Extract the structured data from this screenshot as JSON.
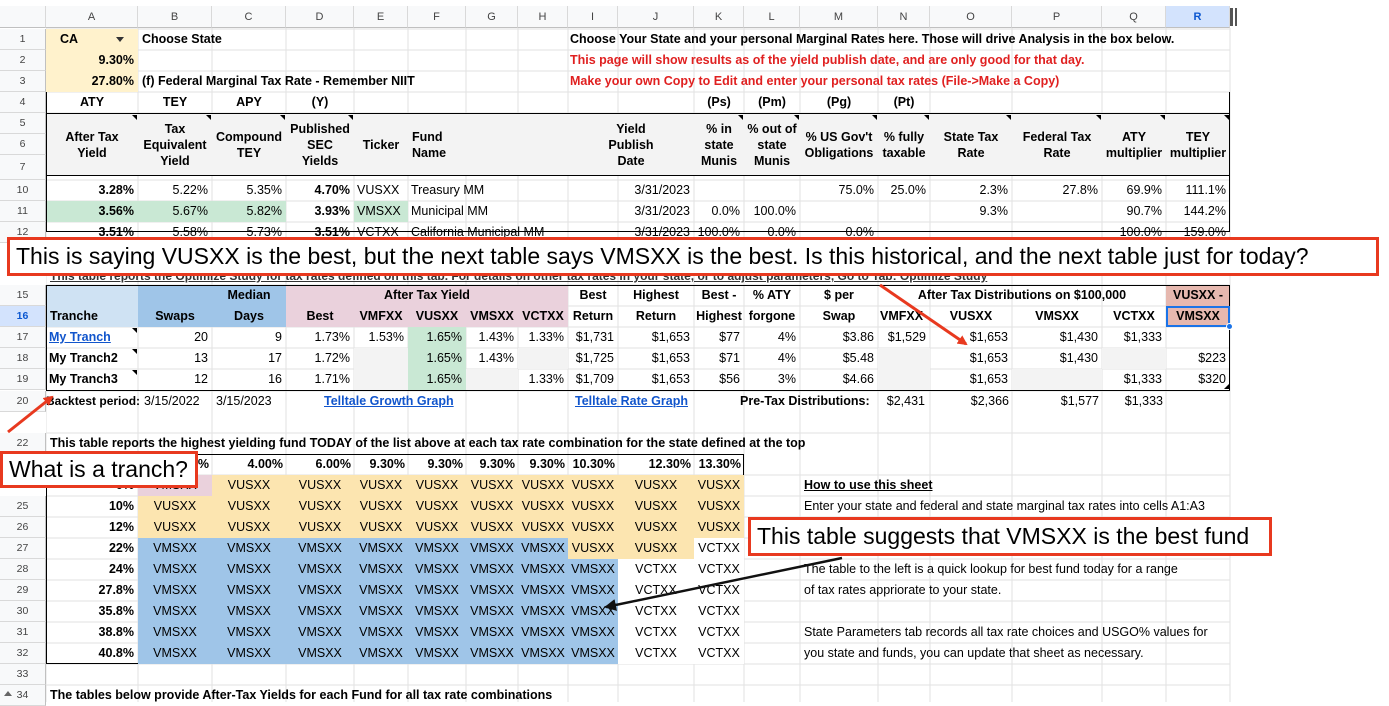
{
  "columns": [
    "A",
    "B",
    "C",
    "D",
    "E",
    "F",
    "G",
    "H",
    "I",
    "J",
    "K",
    "L",
    "M",
    "N",
    "O",
    "P",
    "Q",
    "R"
  ],
  "selected_column": "R",
  "row_numbers": [
    "1",
    "2",
    "3",
    "4",
    "5",
    "6",
    "7",
    "10",
    "11",
    "12",
    "15",
    "16",
    "17",
    "18",
    "19",
    "20",
    "22",
    "25",
    "26",
    "27",
    "28",
    "29",
    "30",
    "31",
    "32",
    "33",
    "34"
  ],
  "selected_row": "16",
  "state_select": {
    "value": "CA"
  },
  "top": {
    "choose_state": "Choose State",
    "state_rate": "9.30%",
    "fed_rate": "27.80%",
    "fed_label": "(f) Federal Marginal Tax Rate - Remember NIIT",
    "instr1": "Choose Your State and your personal Marginal Rates here. Those will drive Analysis in the box below.",
    "instr2": "This page will show results as of the yield publish date, and are only good for that day.",
    "instr3": "Make your own Copy to Edit and enter your personal tax rates (File->Make a Copy)"
  },
  "hdr_row4": {
    "a": "ATY",
    "b": "TEY",
    "c": "APY",
    "d": "(Y)",
    "k": "(Ps)",
    "l": "(Pm)",
    "m": "(Pg)",
    "n": "(Pt)"
  },
  "headers": {
    "a": "After Tax\nYield",
    "b": "Tax\nEquivalent\nYield",
    "c": "Compound\nTEY",
    "d": "Published\nSEC\nYields",
    "e": "Ticker",
    "f": "Fund\nName",
    "j": "Yield\nPublish\nDate",
    "k": "% in\nstate\nMunis",
    "l": "% out of\nstate\nMunis",
    "m": "% US Gov't\nObligations",
    "n": "% fully\ntaxable",
    "o": "State Tax\nRate",
    "p": "Federal Tax\nRate",
    "q": "ATY\nmultiplier",
    "r": "TEY\nmultiplier"
  },
  "fund_rows": [
    {
      "rn": "10",
      "a": "3.28%",
      "b": "5.22%",
      "c": "5.35%",
      "d": "4.70%",
      "e": "VUSXX",
      "f": "Treasury MM",
      "j": "3/31/2023",
      "k": "",
      "l": "",
      "m": "75.0%",
      "n": "25.0%",
      "o": "2.3%",
      "p": "27.8%",
      "q": "69.9%",
      "r": "111.1%"
    },
    {
      "rn": "11",
      "a": "3.56%",
      "b": "5.67%",
      "c": "5.82%",
      "d": "3.93%",
      "e": "VMSXX",
      "f": "Municipal MM",
      "j": "3/31/2023",
      "k": "0.0%",
      "l": "100.0%",
      "m": "",
      "n": "",
      "o": "9.3%",
      "p": "",
      "q": "90.7%",
      "r": "144.2%"
    },
    {
      "rn": "12",
      "a": "3.51%",
      "b": "5.58%",
      "c": "5.73%",
      "d": "3.51%",
      "e": "VCTXX",
      "f": "California Municipal MM",
      "j": "3/31/2023",
      "k": "100.0%",
      "l": "0.0%",
      "m": "0.0%",
      "n": "",
      "o": "",
      "p": "",
      "q": "100.0%",
      "r": "159.0%"
    }
  ],
  "partial_row14": "This table reports the Optimize Study for tax rates defined on this tab. For details on other tax rates in your state, or to adjust parameters, Go to Tab: Optimize Study",
  "opt": {
    "median": "Median",
    "aty": "After Tax Yield",
    "best": "Best",
    "highest": "Highest",
    "best_minus": "Best -",
    "pct_aty": "% ATY",
    "per": "$ per",
    "dist": "After Tax Distributions on $100,000",
    "vusxx_minus": "VUSXX -",
    "tranche": "Tranche",
    "swaps": "Swaps",
    "days": "Days",
    "best2": "Best",
    "vmfxx": "VMFXX",
    "vusxx": "VUSXX",
    "vmsxx": "VMSXX",
    "vctxx": "VCTXX",
    "ret": "Return",
    "ret2": "Return",
    "highest2": "Highest",
    "forgone": "forgone",
    "swap": "Swap",
    "d_vmfxx": "VMFXX",
    "d_vusxx": "VUSXX",
    "d_vmsxx": "VMSXX",
    "d_vctxx": "VCTXX",
    "r_vmsxx": "VMSXX"
  },
  "tranches": [
    {
      "name": "My Tranch",
      "swaps": "20",
      "days": "9",
      "best": "1.73%",
      "vmfxx": "1.53%",
      "vusxx": "1.65%",
      "vmsxx": "1.43%",
      "vctxx": "1.33%",
      "bret": "$1,731",
      "hret": "$1,653",
      "bmh": "$77",
      "pct": "4%",
      "per": "$3.86",
      "d1": "$1,529",
      "d2": "$1,653",
      "d3": "$1,430",
      "d4": "$1,333",
      "r": ""
    },
    {
      "name": "My Tranch2",
      "swaps": "13",
      "days": "17",
      "best": "1.72%",
      "vmfxx": "",
      "vusxx": "1.65%",
      "vmsxx": "1.43%",
      "vctxx": "",
      "bret": "$1,725",
      "hret": "$1,653",
      "bmh": "$71",
      "pct": "4%",
      "per": "$5.48",
      "d1": "",
      "d2": "$1,653",
      "d3": "$1,430",
      "d4": "",
      "r": "$223"
    },
    {
      "name": "My Tranch3",
      "swaps": "12",
      "days": "16",
      "best": "1.71%",
      "vmfxx": "",
      "vusxx": "1.65%",
      "vmsxx": "",
      "vctxx": "1.33%",
      "bret": "$1,709",
      "hret": "$1,653",
      "bmh": "$56",
      "pct": "3%",
      "per": "$4.66",
      "d1": "",
      "d2": "$1,653",
      "d3": "",
      "d4": "$1,333",
      "r": "$320"
    }
  ],
  "row20": {
    "backtest": "Backtest period:",
    "start": "3/15/2022",
    "end": "3/15/2023",
    "growth": "Telltale Growth  Graph",
    "rate": "Telltale Rate Graph",
    "pretax": "Pre-Tax  Distributions:",
    "v1": "$2,431",
    "v2": "$2,366",
    "v3": "$1,577",
    "v4": "$1,333"
  },
  "row22": "This table reports the highest yielding fund TODAY of the list above at each tax rate combination for the state defined at the top",
  "state_rates": [
    "0%",
    "4.00%",
    "6.00%",
    "9.30%",
    "9.30%",
    "9.30%",
    "9.30%",
    "10.30%",
    "12.30%",
    "13.30%"
  ],
  "lookup": [
    {
      "rn": "24",
      "rate": "0%",
      "cells": [
        "VMSXX",
        "VUSXX",
        "VUSXX",
        "VUSXX",
        "VUSXX",
        "VUSXX",
        "VUSXX",
        "VUSXX",
        "VUSXX",
        "VUSXX"
      ]
    },
    {
      "rn": "25",
      "rate": "10%",
      "cells": [
        "VUSXX",
        "VUSXX",
        "VUSXX",
        "VUSXX",
        "VUSXX",
        "VUSXX",
        "VUSXX",
        "VUSXX",
        "VUSXX",
        "VUSXX"
      ]
    },
    {
      "rn": "26",
      "rate": "12%",
      "cells": [
        "VUSXX",
        "VUSXX",
        "VUSXX",
        "VUSXX",
        "VUSXX",
        "VUSXX",
        "VUSXX",
        "VUSXX",
        "VUSXX",
        "VUSXX"
      ]
    },
    {
      "rn": "27",
      "rate": "22%",
      "cells": [
        "VMSXX",
        "VMSXX",
        "VMSXX",
        "VMSXX",
        "VMSXX",
        "VMSXX",
        "VMSXX",
        "VUSXX",
        "VUSXX",
        "VCTXX"
      ]
    },
    {
      "rn": "28",
      "rate": "24%",
      "cells": [
        "VMSXX",
        "VMSXX",
        "VMSXX",
        "VMSXX",
        "VMSXX",
        "VMSXX",
        "VMSXX",
        "VMSXX",
        "VCTXX",
        "VCTXX"
      ]
    },
    {
      "rn": "29",
      "rate": "27.8%",
      "cells": [
        "VMSXX",
        "VMSXX",
        "VMSXX",
        "VMSXX",
        "VMSXX",
        "VMSXX",
        "VMSXX",
        "VMSXX",
        "VCTXX",
        "VCTXX"
      ]
    },
    {
      "rn": "30",
      "rate": "35.8%",
      "cells": [
        "VMSXX",
        "VMSXX",
        "VMSXX",
        "VMSXX",
        "VMSXX",
        "VMSXX",
        "VMSXX",
        "VMSXX",
        "VCTXX",
        "VCTXX"
      ]
    },
    {
      "rn": "31",
      "rate": "38.8%",
      "cells": [
        "VMSXX",
        "VMSXX",
        "VMSXX",
        "VMSXX",
        "VMSXX",
        "VMSXX",
        "VMSXX",
        "VMSXX",
        "VCTXX",
        "VCTXX"
      ]
    },
    {
      "rn": "32",
      "rate": "40.8%",
      "cells": [
        "VMSXX",
        "VMSXX",
        "VMSXX",
        "VMSXX",
        "VMSXX",
        "VMSXX",
        "VMSXX",
        "VMSXX",
        "VCTXX",
        "VCTXX"
      ]
    }
  ],
  "howto": {
    "title": "How to use this sheet",
    "l1": "Enter your state and federal and state marginal tax rates into cells A1:A3",
    "l2": "The table to the left is a quick lookup for best fund today for a range",
    "l3": "of tax rates appriorate to your state.",
    "l4": "State Parameters tab records all tax rate choices and USGO% values for",
    "l5": "you state and funds, you can update that sheet as necessary."
  },
  "row34": "The tables below provide After-Tax Yields for each Fund for all tax rate combinations",
  "annotations": {
    "a1": "This is saying VUSXX is the best, but the next table says VMSXX is the best.  Is this historical, and the next table just for today?",
    "a2": "What is a tranch?",
    "a3": "This table suggests that VMSXX is the best fund"
  },
  "colors": {
    "annotation_border": "#e8391f",
    "red_text": "#e02020",
    "link": "#1155cc",
    "grid": "#d9d9d9"
  }
}
